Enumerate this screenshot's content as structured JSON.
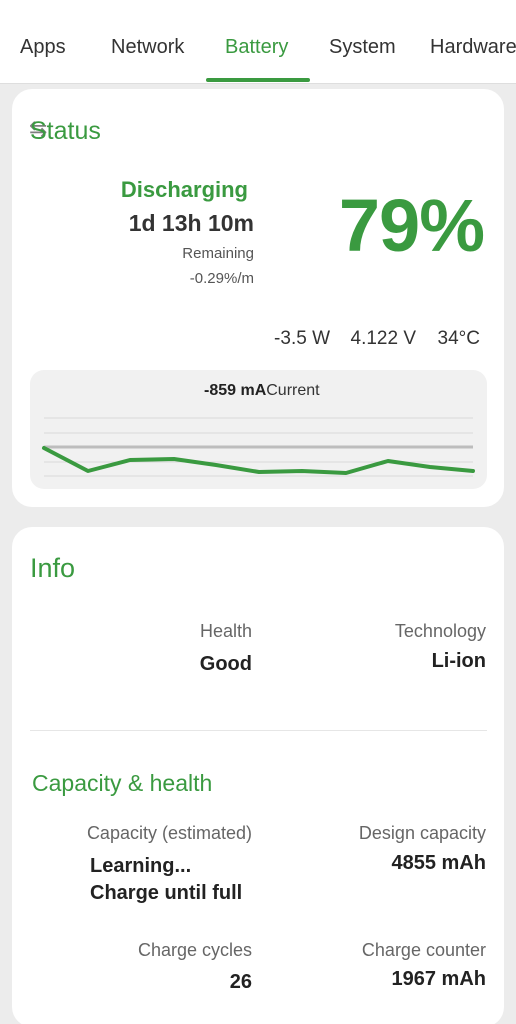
{
  "tabs": [
    {
      "label": "Apps"
    },
    {
      "label": "Network"
    },
    {
      "label": "Battery"
    },
    {
      "label": "System"
    },
    {
      "label": "Hardware"
    }
  ],
  "active_tab": "Battery",
  "colors": {
    "accent": "#3a9a40",
    "card": "#ffffff",
    "background": "#ececec"
  },
  "status": {
    "title": "Status",
    "state": "Discharging",
    "time_left": "1d 13h 10m",
    "remaining_label": "Remaining",
    "rate": "-0.29%/m",
    "percent": "79%",
    "power": "-3.5 W",
    "voltage": "4.122 V",
    "temperature": "34°C",
    "graph": {
      "value": "-859 mA",
      "label": "Current"
    }
  },
  "info": {
    "title": "Info",
    "health_label": "Health",
    "health_value": "Good",
    "technology_label": "Technology",
    "technology_value": "Li-ion",
    "capacity_title": "Capacity & health",
    "capacity_est_label": "Capacity (estimated)",
    "capacity_est_line1": "Learning...",
    "capacity_est_line2": "Charge until full",
    "design_capacity_label": "Design capacity",
    "design_capacity_value": "4855 mAh",
    "charge_cycles_label": "Charge cycles",
    "charge_cycles_value": "26",
    "charge_counter_label": "Charge counter",
    "charge_counter_value": "1967 mAh"
  }
}
